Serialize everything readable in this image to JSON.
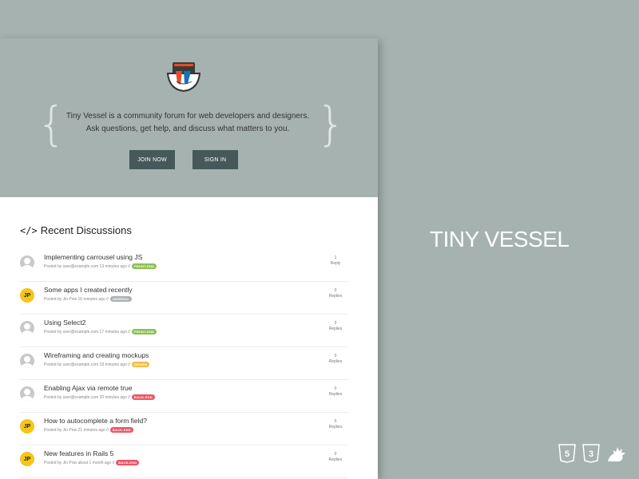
{
  "hero": {
    "tagline_line1": "Tiny Vessel is a community forum for web developers and designers.",
    "tagline_line2": "Ask questions, get help, and discuss what matters to you.",
    "join_label": "JOIN NOW",
    "signin_label": "SIGN IN",
    "logo_icon": "bowl-logo-icon"
  },
  "discussions": {
    "heading": "Recent Discussions",
    "heading_icon": "code-icon",
    "items": [
      {
        "title": "Implementing carrousel using JS",
        "meta": "Posted by user@example.com 13 minutes ago //",
        "tag": "FRONT-END",
        "tag_color": "#8cc152",
        "count": "1",
        "count_label": "Reply",
        "avatar": "default-avatar-icon"
      },
      {
        "title": "Some apps I created recently",
        "meta": "Posted by Jin Pow 16 minutes ago //",
        "tag": "GENERAL",
        "tag_color": "#aab2b3",
        "count": "0",
        "count_label": "Replies",
        "avatar": "JP"
      },
      {
        "title": "Using Select2",
        "meta": "Posted by user@example.com 17 minutes ago //",
        "tag": "FRONT-END",
        "tag_color": "#8cc152",
        "count": "0",
        "count_label": "Replies",
        "avatar": "default-avatar-icon"
      },
      {
        "title": "Wireframing and creating mockups",
        "meta": "Posted by user@example.com 18 minutes ago //",
        "tag": "DESIGN",
        "tag_color": "#f6bb42",
        "count": "0",
        "count_label": "Replies",
        "avatar": "default-avatar-icon"
      },
      {
        "title": "Enabling Ajax via remote true",
        "meta": "Posted by user@example.com 20 minutes ago //",
        "tag": "BACK-END",
        "tag_color": "#ed5565",
        "count": "0",
        "count_label": "Replies",
        "avatar": "default-avatar-icon"
      },
      {
        "title": "How to autocomplete a form field?",
        "meta": "Posted by Jin Pow 21 minutes ago //",
        "tag": "BACK-END",
        "tag_color": "#ed5565",
        "count": "0",
        "count_label": "Replies",
        "avatar": "JP"
      },
      {
        "title": "New features in Rails 5",
        "meta": "Posted by Jin Pow about 1 month ago //",
        "tag": "BACK-END",
        "tag_color": "#ed5565",
        "count": "0",
        "count_label": "Replies",
        "avatar": "JP"
      }
    ]
  },
  "brand": {
    "title": "TINY VESSEL",
    "icons": [
      "html5-icon",
      "css3-icon",
      "dragon-icon"
    ]
  },
  "colors": {
    "background": "#a5b2b0",
    "button": "#45595a",
    "avatar_jp": "#f5c518"
  }
}
